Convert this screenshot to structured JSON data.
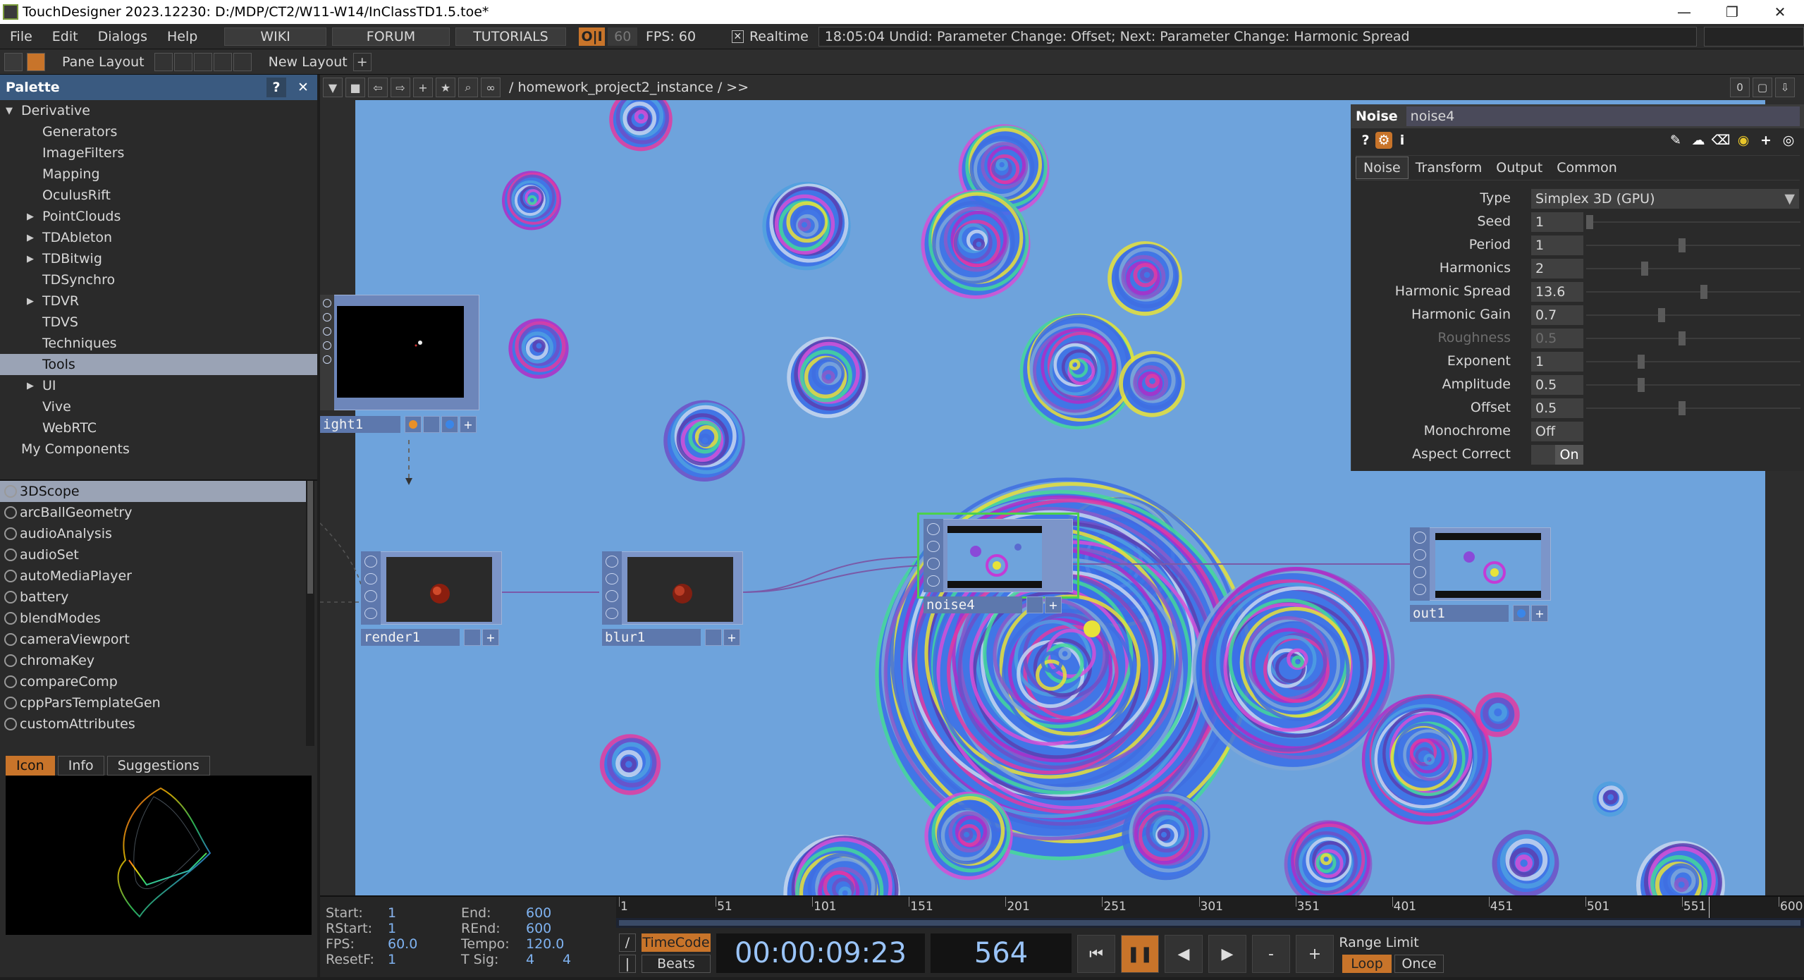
{
  "window": {
    "title": "TouchDesigner 2023.12230: D:/MDP/CT2/W11-W14/InClassTD1.5.toe*"
  },
  "menubar": {
    "items": [
      "File",
      "Edit",
      "Dialogs",
      "Help"
    ],
    "wiki": "WIKI",
    "forum": "FORUM",
    "tutorials": "TUTORIALS",
    "oi": "O|I",
    "fps_target": "60",
    "fps": "FPS:  60",
    "realtime": "Realtime",
    "undo": "18:05:04 Undid: Parameter Change: Offset; Next: Parameter Change: Harmonic Spread"
  },
  "panebar": {
    "pane_layout": "Pane Layout",
    "new_layout": "New Layout"
  },
  "palette": {
    "title": "Palette",
    "tree": [
      {
        "label": "Derivative",
        "level": 0,
        "arrow": "▼"
      },
      {
        "label": "Generators",
        "level": 2,
        "arrow": ""
      },
      {
        "label": "ImageFilters",
        "level": 2,
        "arrow": ""
      },
      {
        "label": "Mapping",
        "level": 2,
        "arrow": ""
      },
      {
        "label": "OculusRift",
        "level": 2,
        "arrow": ""
      },
      {
        "label": "PointClouds",
        "level": 1,
        "arrow": "▶"
      },
      {
        "label": "TDAbleton",
        "level": 1,
        "arrow": "▶"
      },
      {
        "label": "TDBitwig",
        "level": 1,
        "arrow": "▶"
      },
      {
        "label": "TDSynchro",
        "level": 2,
        "arrow": ""
      },
      {
        "label": "TDVR",
        "level": 1,
        "arrow": "▶"
      },
      {
        "label": "TDVS",
        "level": 2,
        "arrow": ""
      },
      {
        "label": "Techniques",
        "level": 2,
        "arrow": ""
      },
      {
        "label": "Tools",
        "level": 2,
        "arrow": "",
        "selected": true
      },
      {
        "label": "UI",
        "level": 1,
        "arrow": "▶"
      },
      {
        "label": "Vive",
        "level": 2,
        "arrow": ""
      },
      {
        "label": "WebRTC",
        "level": 2,
        "arrow": ""
      },
      {
        "label": "My Components",
        "level": 0.5,
        "arrow": ""
      }
    ],
    "components": [
      "3DScope",
      "arcBallGeometry",
      "audioAnalysis",
      "audioSet",
      "autoMediaPlayer",
      "battery",
      "blendModes",
      "cameraViewport",
      "chromaKey",
      "compareComp",
      "cppParsTemplateGen",
      "customAttributes"
    ],
    "tabs": [
      "Icon",
      "Info",
      "Suggestions"
    ]
  },
  "network": {
    "path": "/ homework_project2_instance / >>",
    "right_value": "0",
    "nodes": {
      "light1": "ight1",
      "render1": "render1",
      "blur1": "blur1",
      "noise4": "noise4",
      "out1": "out1"
    }
  },
  "params": {
    "op_type": "Noise",
    "op_name": "noise4",
    "tabs": [
      "Noise",
      "Transform",
      "Output",
      "Common"
    ],
    "rows": [
      {
        "label": "Type",
        "value": "Simplex 3D (GPU)",
        "kind": "menu"
      },
      {
        "label": "Seed",
        "value": "1",
        "kind": "slider",
        "pos": 0.0
      },
      {
        "label": "Period",
        "value": "1",
        "kind": "slider",
        "pos": 0.45
      },
      {
        "label": "Harmonics",
        "value": "2",
        "kind": "slider",
        "pos": 0.27
      },
      {
        "label": "Harmonic Spread",
        "value": "13.6",
        "kind": "slider",
        "pos": 0.56
      },
      {
        "label": "Harmonic Gain",
        "value": "0.7",
        "kind": "slider",
        "pos": 0.35
      },
      {
        "label": "Roughness",
        "value": "0.5",
        "kind": "slider",
        "pos": 0.45,
        "disabled": true
      },
      {
        "label": "Exponent",
        "value": "1",
        "kind": "slider",
        "pos": 0.25
      },
      {
        "label": "Amplitude",
        "value": "0.5",
        "kind": "slider",
        "pos": 0.25
      },
      {
        "label": "Offset",
        "value": "0.5",
        "kind": "slider",
        "pos": 0.45
      },
      {
        "label": "Monochrome",
        "value": "Off",
        "kind": "toggle",
        "state": ""
      },
      {
        "label": "Aspect Correct",
        "value": "",
        "kind": "toggle",
        "state": "On"
      }
    ]
  },
  "timeline": {
    "start_label": "Start:",
    "start": "1",
    "rstart_label": "RStart:",
    "rstart": "1",
    "fps_label": "FPS:",
    "fps": "60.0",
    "resetf_label": "ResetF:",
    "resetf": "1",
    "end_label": "End:",
    "end": "600",
    "rend_label": "REnd:",
    "rend": "600",
    "tempo_label": "Tempo:",
    "tempo": "120.0",
    "tsig_label": "T Sig:",
    "tsig_a": "4",
    "tsig_b": "4",
    "ruler": [
      "1",
      "51",
      "101",
      "151",
      "201",
      "251",
      "301",
      "351",
      "401",
      "451",
      "501",
      "551",
      "600"
    ],
    "timecode_label": "TimeCode",
    "beats_label": "Beats",
    "timecode": "00:00:09:23",
    "frame": "564",
    "range_limit": "Range Limit",
    "loop": "Loop",
    "once": "Once"
  }
}
